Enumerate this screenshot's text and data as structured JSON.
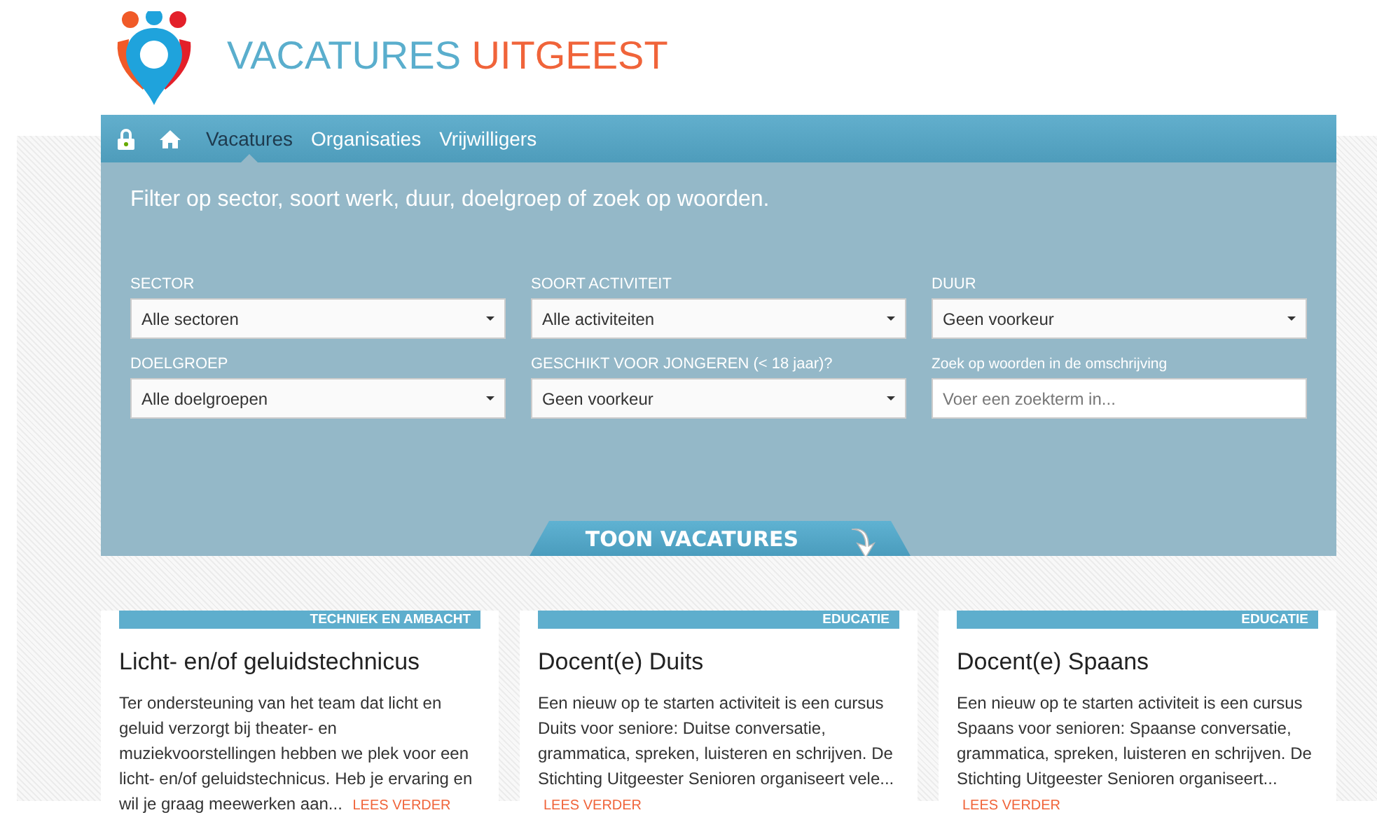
{
  "brand": {
    "part_1": "VACATURES",
    "part_2": "UITGEEST"
  },
  "nav": [
    {
      "kind": "lock"
    },
    {
      "kind": "home"
    },
    {
      "kind": "text",
      "label": "Vacatures",
      "selected": true
    },
    {
      "kind": "text",
      "label": "Organisaties",
      "selected": false
    },
    {
      "kind": "text",
      "label": "Vrijwilligers",
      "selected": false
    }
  ],
  "filter": {
    "title": "Filter op sector, soort werk, duur, doelgroep of zoek op woorden.",
    "fields": [
      {
        "kind": "select",
        "label": "SECTOR",
        "value": "Alle sectoren"
      },
      {
        "kind": "select",
        "label": "SOORT ACTIVITEIT",
        "value": "Alle activiteiten"
      },
      {
        "kind": "select",
        "label": "DUUR",
        "value": "Geen voorkeur"
      },
      {
        "kind": "select",
        "label": "DOELGROEP",
        "value": "Alle doelgroepen"
      },
      {
        "kind": "select",
        "label": "GESCHIKT VOOR JONGEREN (< 18 jaar)?",
        "value": "Geen voorkeur"
      },
      {
        "kind": "text",
        "label": "Zoek op woorden in de omschrijving",
        "placeholder": "Voer een zoekterm in..."
      }
    ],
    "button": "TOON VACATURES"
  },
  "cards": [
    {
      "tag": "TECHNIEK EN AMBACHT",
      "title": "Licht- en/of geluidstechnicus",
      "text": "Ter ondersteuning van het team dat licht en geluid verzorgt bij theater- en muziekvoorstellingen hebben we plek voor een licht- en/of geluidstechnicus. Heb je ervaring en wil je graag meewerken aan...",
      "link": "LEES VERDER"
    },
    {
      "tag": "EDUCATIE",
      "title": "Docent(e) Duits",
      "text": "Een nieuw op te starten activiteit is een cursus Duits voor seniore: Duitse conversatie, grammatica, spreken, luisteren en schrijven. De Stichting Uitgeester Senioren organiseert vele...",
      "link": "LEES VERDER"
    },
    {
      "tag": "EDUCATIE",
      "title": "Docent(e) Spaans",
      "text": "Een nieuw op te starten activiteit is een cursus Spaans voor senioren: Spaanse conversatie, grammatica, spreken, luisteren en schrijven. De Stichting Uitgeester Senioren organiseert...",
      "link": "LEES VERDER"
    }
  ]
}
